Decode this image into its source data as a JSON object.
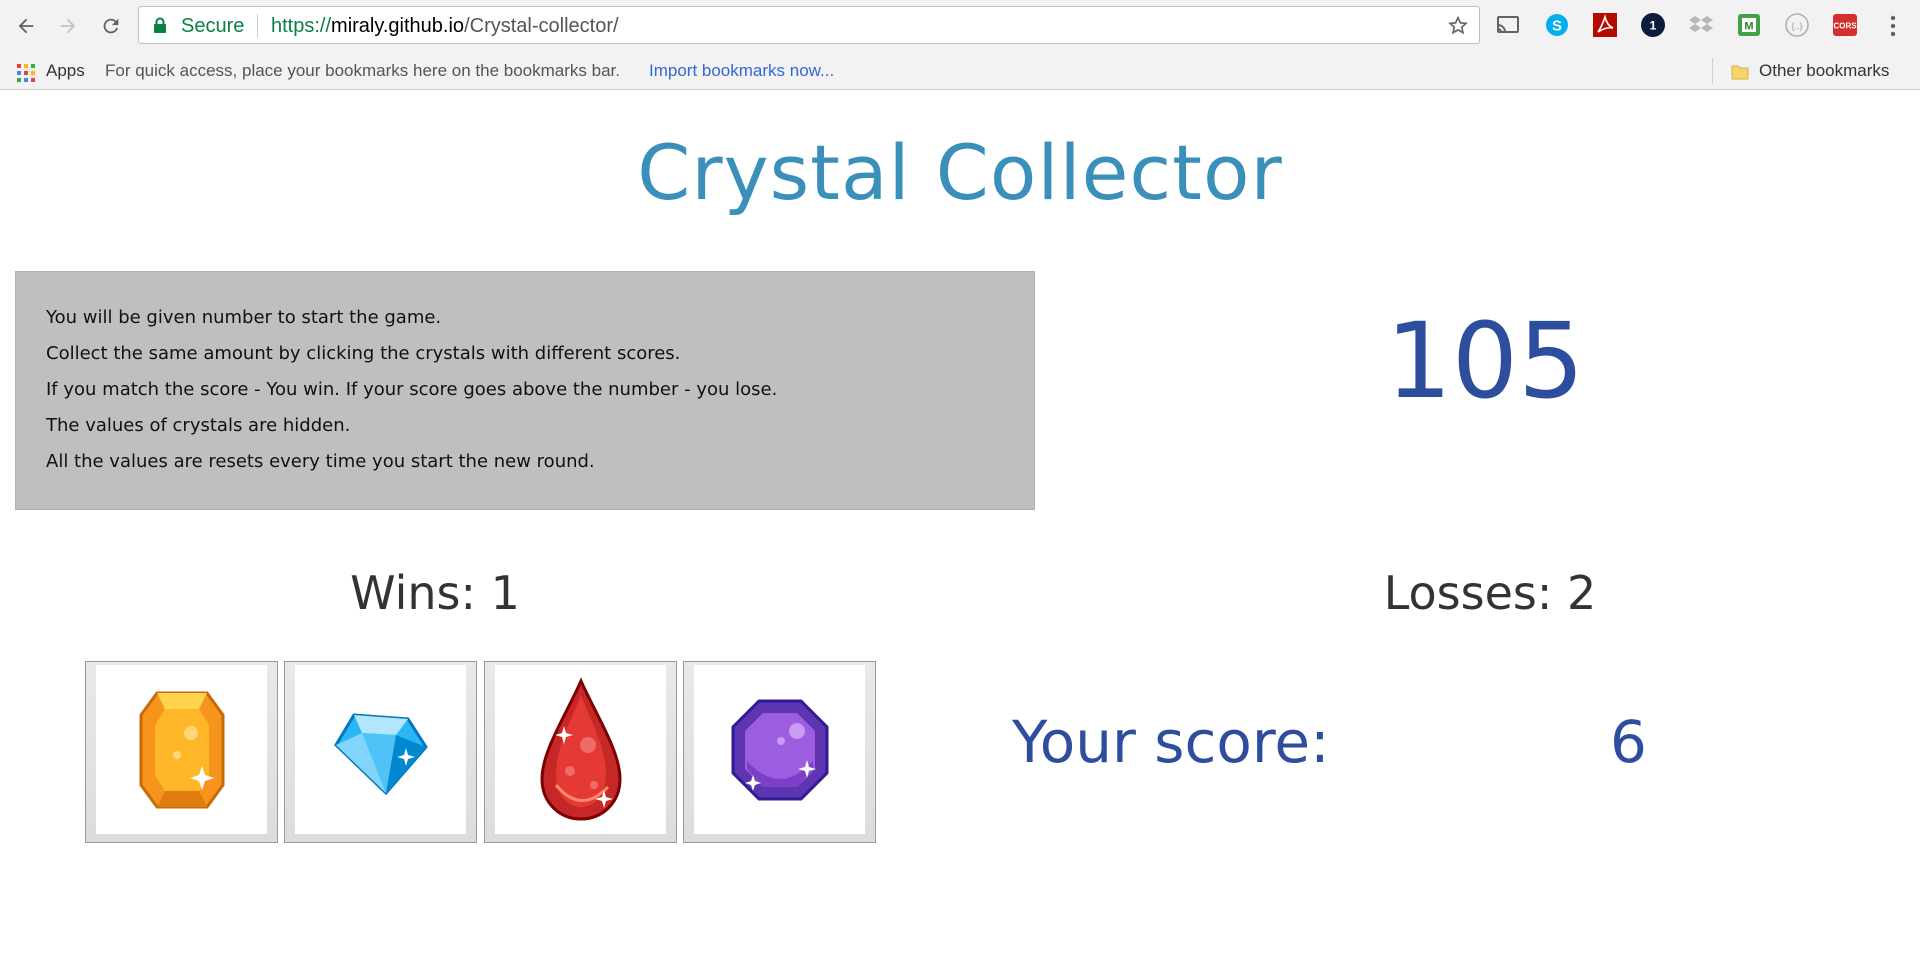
{
  "browser": {
    "secure_label": "Secure",
    "url_scheme": "https://",
    "url_host": "miraly.github.io",
    "url_path": "/Crystal-collector/",
    "extensions": [
      "cast-icon",
      "skype-icon",
      "acrobat-icon",
      "onepassword-icon",
      "dropbox-icon",
      "extension-m-icon",
      "extension-circle-icon",
      "cors-icon"
    ],
    "cors_badge": "CORS",
    "onepassword_badge": "1"
  },
  "bookmarks_bar": {
    "apps_label": "Apps",
    "hint": "For quick access, place your bookmarks here on the bookmarks bar.",
    "import_link": "Import bookmarks now...",
    "other_bookmarks": "Other bookmarks"
  },
  "game": {
    "title": "Crystal Collector",
    "instructions": [
      "You will be given number to start the game.",
      "Collect the same amount by clicking the crystals with different scores.",
      "If you match the score - You win. If your score goes above the number - you lose.",
      "The values of crystals are hidden.",
      "All the values are resets every time you start the new round."
    ],
    "target_number": "105",
    "wins_text": "Wins: 1",
    "losses_text": "Losses: 2",
    "score_label": "Your score:",
    "score_value": "6",
    "crystals": [
      "orange-crystal",
      "blue-diamond",
      "red-drop-crystal",
      "purple-crystal"
    ]
  },
  "colors": {
    "title": "#3a8fbb",
    "numbers": "#2d4d9e",
    "instructions_bg": "#bfbfbf"
  }
}
